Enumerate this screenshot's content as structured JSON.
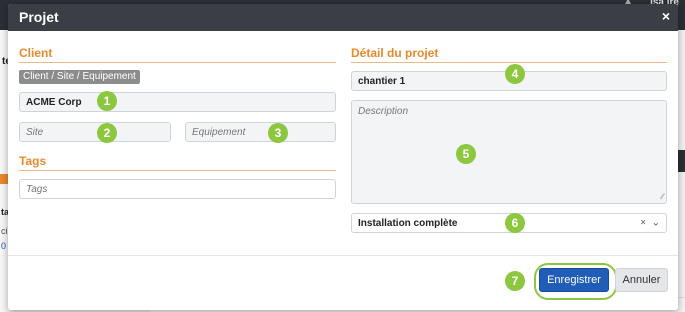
{
  "background": {
    "top_right_text": "ısa ıre",
    "left_t": "te",
    "left_a": "ta",
    "left_b": "ci",
    "left_c": "0"
  },
  "modal": {
    "title": "Projet",
    "close_glyph": "×",
    "client": {
      "section_title": "Client",
      "badge": "Client / Site / Equipement",
      "client_value": "ACME Corp",
      "site_placeholder": "Site",
      "equipment_placeholder": "Equipement"
    },
    "tags": {
      "section_title": "Tags",
      "placeholder": "Tags"
    },
    "project": {
      "section_title": "Détail du projet",
      "name_value": "chantier 1",
      "description_placeholder": "Description",
      "type_value": "Installation complète",
      "clear_glyph": "×",
      "chevron_glyph": "⌄"
    },
    "footer": {
      "save_label": "Enregistrer",
      "cancel_label": "Annuler"
    }
  },
  "callouts": [
    "1",
    "2",
    "3",
    "4",
    "5",
    "6",
    "7"
  ],
  "colors": {
    "accent": "#e8892b",
    "callout": "#8dc63f",
    "primary_button": "#1f5db8",
    "header": "#3b3f45"
  }
}
